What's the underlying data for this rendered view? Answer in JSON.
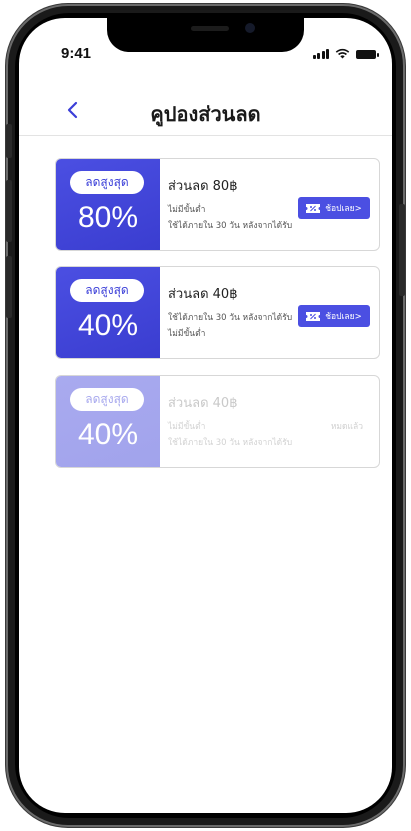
{
  "status_bar": {
    "time": "9:41"
  },
  "header": {
    "title": "คูปองส่วนลด"
  },
  "coupons": [
    {
      "badge": "ลดสูงสุด",
      "percent": "80%",
      "name": "ส่วนลด 80฿",
      "line1": "ไม่มีขั้นต่ำ",
      "line2": "ใช้ได้ภายใน 30 วัน หลังจากได้รับ",
      "action_label": "ช้อปเลย>",
      "state": "active"
    },
    {
      "badge": "ลดสูงสุด",
      "percent": "40%",
      "name": "ส่วนลด 40฿",
      "line1": "ใช้ได้ภายใน 30 วัน หลังจากได้รับ",
      "line2": "ไม่มีขั้นต่ำ",
      "action_label": "ช้อปเลย>",
      "state": "active"
    },
    {
      "badge": "ลดสูงสุด",
      "percent": "40%",
      "name": "ส่วนลด 40฿",
      "line1": "ไม่มีขั้นต่ำ",
      "line2": "ใช้ได้ภายใน 30 วัน หลังจากได้รับ",
      "status_label": "หมดแล้ว",
      "state": "disabled"
    }
  ],
  "colors": {
    "accent": "#3b3fd8",
    "accent_light": "#a8a9ee",
    "border": "#d7d7d7"
  },
  "icons": {
    "back": "chevron-left-icon",
    "ticket": "ticket-percent-icon"
  }
}
